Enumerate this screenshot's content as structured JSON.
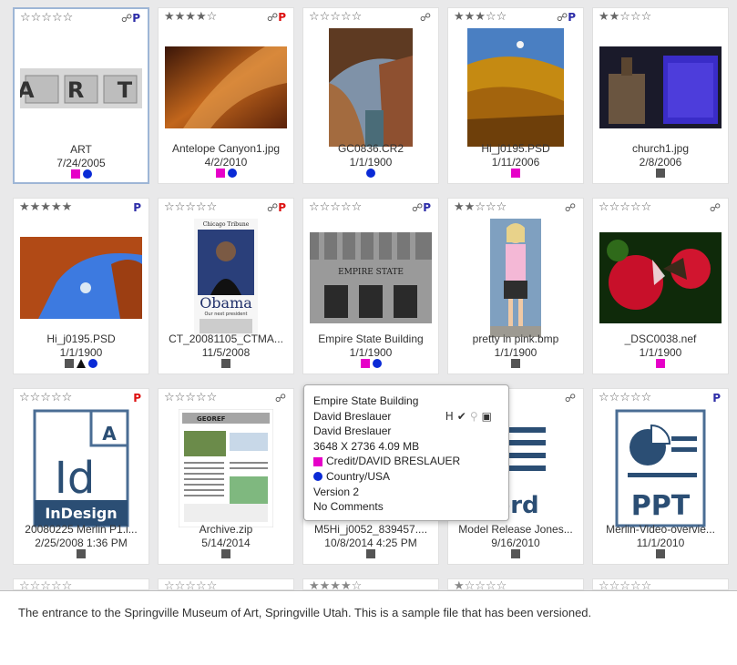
{
  "colors": {
    "magenta": "#e600c8",
    "blue": "#0a2ad6",
    "gray": "#555555",
    "flag_purple": "#2d2da8",
    "flag_red": "#d11"
  },
  "cards": [
    {
      "stars": 0,
      "flags": "link+p",
      "name": "ART",
      "date": "7/24/2005",
      "marks": [
        "magenta-sq",
        "blue-dot"
      ],
      "thumb": "art"
    },
    {
      "stars": 4,
      "flags": "link+p-red",
      "name": "Antelope Canyon1.jpg",
      "date": "4/2/2010",
      "marks": [
        "magenta-sq",
        "blue-dot"
      ],
      "thumb": "canyon"
    },
    {
      "stars": 0,
      "flags": "link",
      "name": "GC0836.CR2",
      "date": "1/1/1900",
      "marks": [
        "blue-dot"
      ],
      "thumb": "gorge"
    },
    {
      "stars": 3,
      "flags": "link+p",
      "name": "Hi_j0195.PSD",
      "date": "1/11/2006",
      "marks": [
        "magenta-sq"
      ],
      "thumb": "aspen"
    },
    {
      "stars": 2,
      "flags": "",
      "name": "church1.jpg",
      "date": "2/8/2006",
      "marks": [
        "gray-sq"
      ],
      "thumb": "church"
    },
    {
      "stars": 5,
      "flags": "p-blue",
      "name": "Hi_j0195.PSD",
      "date": "1/1/1900",
      "marks": [
        "gray-sq",
        "black-tri",
        "blue-dot"
      ],
      "thumb": "arch"
    },
    {
      "stars": 0,
      "flags": "link+p-red",
      "name": "CT_20081105_CTMA...",
      "date": "11/5/2008",
      "marks": [
        "gray-sq"
      ],
      "thumb": "obama"
    },
    {
      "stars": 0,
      "flags": "link+p",
      "name": "Empire State Building",
      "date": "1/1/1900",
      "marks": [
        "magenta-sq",
        "blue-dot"
      ],
      "thumb": "empire"
    },
    {
      "stars": 2,
      "flags": "link",
      "name": "pretty in pink.bmp",
      "date": "1/1/1900",
      "marks": [
        "gray-sq"
      ],
      "thumb": "girl"
    },
    {
      "stars": 0,
      "flags": "link",
      "name": "_DSC0038.nef",
      "date": "1/1/1900",
      "marks": [
        "magenta-sq"
      ],
      "thumb": "butterfly"
    },
    {
      "stars": 0,
      "flags": "p-red",
      "name": "20080225 Merlin P1.i...",
      "date": "2/25/2008 1:36 PM",
      "marks": [
        "gray-sq"
      ],
      "thumb": "indesign"
    },
    {
      "stars": 0,
      "flags": "link",
      "name": "Archive.zip",
      "date": "5/14/2014",
      "marks": [
        "gray-sq"
      ],
      "thumb": "archive"
    },
    {
      "stars": 0,
      "flags": "",
      "name": "M5Hi_j0052_839457....",
      "date": "10/8/2014 4:25 PM",
      "marks": [
        "gray-sq"
      ],
      "thumb": "none"
    },
    {
      "stars": 0,
      "flags": "link",
      "name": "Model Release Jones...",
      "date": "9/16/2010",
      "marks": [
        "gray-sq"
      ],
      "thumb": "word"
    },
    {
      "stars": 0,
      "flags": "p",
      "name": "Merlin-Video-overvie...",
      "date": "11/1/2010",
      "marks": [
        "gray-sq"
      ],
      "thumb": "ppt"
    }
  ],
  "peek_stars": [
    0,
    0,
    4,
    1,
    0
  ],
  "thumb_text": {
    "art": "A R T",
    "obama_masthead": "Chicago Tribune",
    "obama_word": "Obama",
    "obama_sub": "Our next president",
    "empire_sign": "EMPIRE STATE",
    "indesign_big": "Id",
    "indesign_label": "InDesign",
    "archive_head": "GEOREF",
    "word_label": "ord",
    "ppt_label": "PPT"
  },
  "tooltip": {
    "title": "Empire State Building",
    "author1": "David Breslauer",
    "author2": "David Breslauer",
    "dimensions": "3648 X 2736   4.09 MB",
    "credit": "Credit/DAVID BRESLAUER",
    "country": "Country/USA",
    "version": "Version 2",
    "comments": "No Comments",
    "status_h": "H"
  },
  "description": "The entrance to the Springville Museum of Art, Springville Utah. This is a sample file that has been versioned."
}
